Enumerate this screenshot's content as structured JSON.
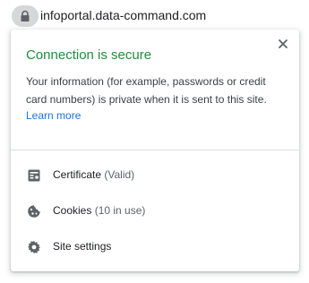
{
  "address_bar": {
    "url_host": "infoportal.data-command.com"
  },
  "popup": {
    "title": "Connection is secure",
    "description": "Your information (for example, passwords or credit card numbers) is private when it is sent to this site.",
    "learn_more": "Learn more",
    "items": [
      {
        "label": "Certificate",
        "detail": "(Valid)",
        "icon": "certificate-icon"
      },
      {
        "label": "Cookies",
        "detail": "(10 in use)",
        "icon": "cookie-icon"
      },
      {
        "label": "Site settings",
        "detail": "",
        "icon": "gear-icon"
      }
    ]
  },
  "colors": {
    "secure_title": "#1e8e3e",
    "link": "#1a73e8",
    "text": "#202124",
    "secondary_text": "#5f6368",
    "lock_chip_bg": "#d6d7d8"
  }
}
